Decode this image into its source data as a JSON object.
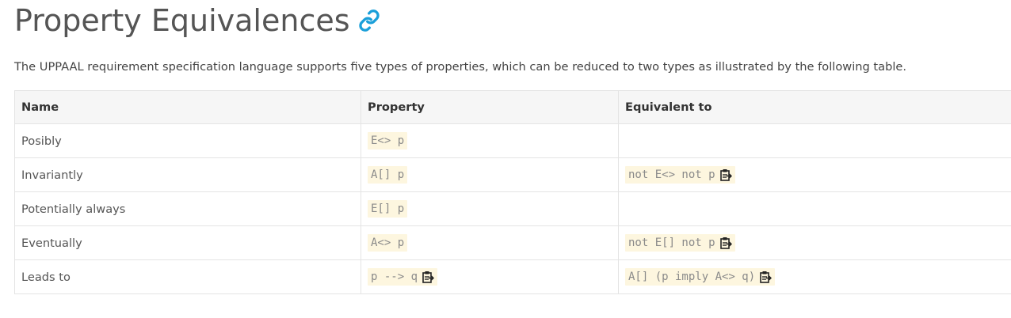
{
  "page": {
    "title": "Property Equivalences",
    "intro": "The UPPAAL requirement specification language supports five types of properties, which can be reduced to two types as illustrated by the following table."
  },
  "icons": {
    "anchor": "link-icon",
    "copy": "clipboard-icon",
    "anchor_color": "#1a9fd9"
  },
  "table": {
    "headers": [
      "Name",
      "Property",
      "Equivalent to"
    ],
    "rows": [
      {
        "name": "Posibly",
        "property": "E<> p",
        "property_copy": false,
        "equivalent": "",
        "equivalent_copy": false
      },
      {
        "name": "Invariantly",
        "property": "A[] p",
        "property_copy": false,
        "equivalent": "not E<> not p",
        "equivalent_copy": true
      },
      {
        "name": "Potentially always",
        "property": "E[] p",
        "property_copy": false,
        "equivalent": "",
        "equivalent_copy": false
      },
      {
        "name": "Eventually",
        "property": "A<> p",
        "property_copy": false,
        "equivalent": "not E[] not p",
        "equivalent_copy": true
      },
      {
        "name": "Leads to",
        "property": "p --> q",
        "property_copy": true,
        "equivalent": "A[] (p imply A<> q)",
        "equivalent_copy": true
      }
    ]
  }
}
